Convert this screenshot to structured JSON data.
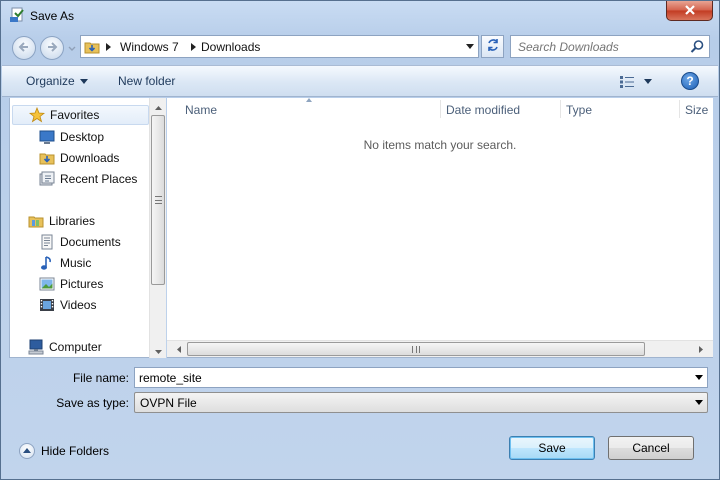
{
  "window": {
    "title": "Save As"
  },
  "address": {
    "crumbs": [
      "Windows 7",
      "Downloads"
    ]
  },
  "search": {
    "placeholder": "Search Downloads"
  },
  "toolbar": {
    "organize": "Organize",
    "new_folder": "New folder",
    "help": "?"
  },
  "navpane": {
    "items": [
      {
        "label": "Favorites",
        "icon": "star-icon",
        "level": 0
      },
      {
        "label": "Desktop",
        "icon": "desktop-icon",
        "level": 1
      },
      {
        "label": "Downloads",
        "icon": "downloads-folder-icon",
        "level": 1
      },
      {
        "label": "Recent Places",
        "icon": "recent-places-icon",
        "level": 1
      },
      {
        "label": "Libraries",
        "icon": "libraries-icon",
        "level": 0
      },
      {
        "label": "Documents",
        "icon": "documents-icon",
        "level": 1
      },
      {
        "label": "Music",
        "icon": "music-icon",
        "level": 1
      },
      {
        "label": "Pictures",
        "icon": "pictures-icon",
        "level": 1
      },
      {
        "label": "Videos",
        "icon": "videos-icon",
        "level": 1
      },
      {
        "label": "Computer",
        "icon": "computer-icon",
        "level": 0
      }
    ]
  },
  "content": {
    "columns": [
      "Name",
      "Date modified",
      "Type",
      "Size"
    ],
    "empty_message": "No items match your search."
  },
  "form": {
    "filename_label": "File name:",
    "filename_value": "remote_site",
    "type_label": "Save as type:",
    "type_value": "OVPN File"
  },
  "footer": {
    "hide_folders": "Hide Folders",
    "save": "Save",
    "cancel": "Cancel"
  },
  "colors": {
    "accent": "#1e395b",
    "frame": "#c1d4ec",
    "close": "#c23b22"
  }
}
